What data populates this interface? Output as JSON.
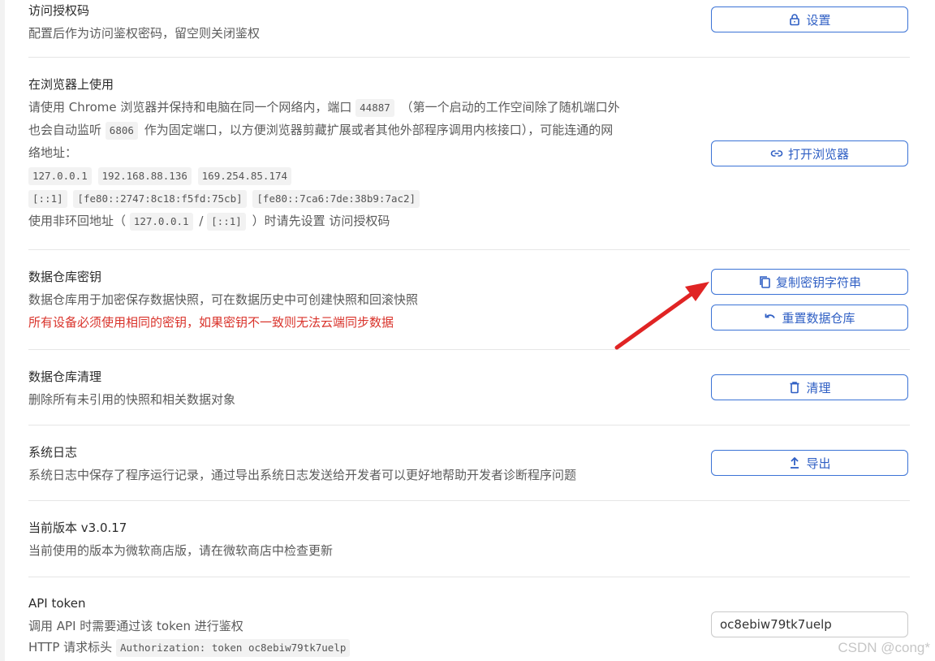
{
  "access": {
    "title": "访问授权码",
    "desc": "配置后作为访问鉴权密码，留空则关闭鉴权",
    "button_label": "设置",
    "icon": "lock-icon"
  },
  "browser": {
    "title": "在浏览器上使用",
    "desc_line1_a": "请使用 Chrome 浏览器并保持和电脑在同一个网络内，端口",
    "port_random": "44887",
    "desc_line1_b": "（第一个启动的工作空间除了随机端口外",
    "desc_line2_a": "也会自动监听",
    "port_fixed": "6806",
    "desc_line2_b": "作为固定端口，以方便浏览器剪藏扩展或者其他外部程序调用内核接口），可能连通的网",
    "desc_line3": "络地址：",
    "addresses_row1": [
      "127.0.0.1",
      "192.168.88.136",
      "169.254.85.174"
    ],
    "addresses_row2": [
      "[::1]",
      "[fe80::2747:8c18:f5fd:75cb]",
      "[fe80::7ca6:7de:38b9:7ac2]"
    ],
    "note_a": "使用非环回地址（",
    "note_code1": "127.0.0.1",
    "note_sep": "/",
    "note_code2": "[::1]",
    "note_b": "）时请先设置 访问授权码",
    "button_label": "打开浏览器",
    "icon": "link-icon"
  },
  "repo_key": {
    "title": "数据仓库密钥",
    "desc": "数据仓库用于加密保存数据快照，可在数据历史中可创建快照和回滚快照",
    "warning": "所有设备必须使用相同的密钥，如果密钥不一致则无法云端同步数据",
    "copy_button_label": "复制密钥字符串",
    "reset_button_label": "重置数据仓库",
    "warning_color": "#d9332b",
    "accent_color": "#2f5fc4"
  },
  "repo_clean": {
    "title": "数据仓库清理",
    "desc": "删除所有未引用的快照和相关数据对象",
    "button_label": "清理",
    "icon": "trash-icon"
  },
  "logs": {
    "title": "系统日志",
    "desc": "系统日志中保存了程序运行记录，通过导出系统日志发送给开发者可以更好地帮助开发者诊断程序问题",
    "button_label": "导出",
    "icon": "upload-icon"
  },
  "version": {
    "title": "当前版本 v3.0.17",
    "desc": "当前使用的版本为微软商店版，请在微软商店中检查更新"
  },
  "api": {
    "title": "API token",
    "desc": "调用 API 时需要通过该 token 进行鉴权",
    "header_label": "HTTP 请求标头",
    "header_code": "Authorization: token oc8ebiw79tk7uelp",
    "token_value": "oc8ebiw79tk7uelp"
  },
  "watermark": "CSDN @cong*",
  "annotation": {
    "arrow_color": "#e02424"
  }
}
